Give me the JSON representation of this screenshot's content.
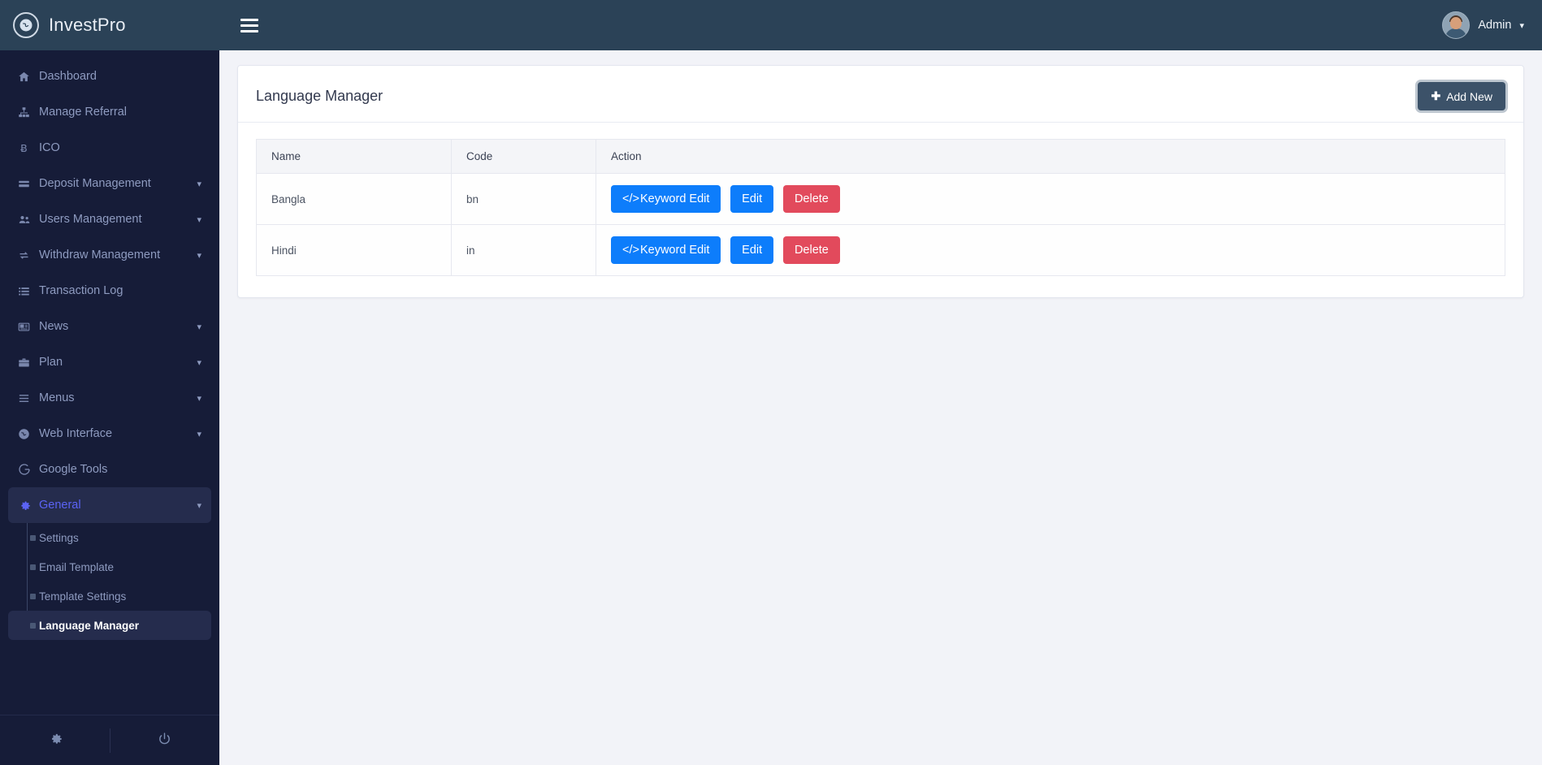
{
  "brand": {
    "name": "InvestPro",
    "logo_icon": "globe-icon"
  },
  "topbar": {
    "menu_icon": "hamburger-icon",
    "admin_label": "Admin",
    "admin_chevron_icon": "chevron-down-icon",
    "avatar_icon": "user-avatar"
  },
  "sidebar": {
    "items": [
      {
        "label": "Dashboard",
        "icon": "home-icon",
        "has_chevron": false,
        "active": false
      },
      {
        "label": "Manage Referral",
        "icon": "sitemap-icon",
        "has_chevron": false,
        "active": false
      },
      {
        "label": "ICO",
        "icon": "bitcoin-icon",
        "has_chevron": false,
        "active": false
      },
      {
        "label": "Deposit Management",
        "icon": "credit-card-icon",
        "has_chevron": true,
        "active": false
      },
      {
        "label": "Users Management",
        "icon": "users-icon",
        "has_chevron": true,
        "active": false
      },
      {
        "label": "Withdraw Management",
        "icon": "exchange-icon",
        "has_chevron": true,
        "active": false
      },
      {
        "label": "Transaction Log",
        "icon": "list-icon",
        "has_chevron": false,
        "active": false
      },
      {
        "label": "News",
        "icon": "newspaper-icon",
        "has_chevron": true,
        "active": false
      },
      {
        "label": "Plan",
        "icon": "briefcase-icon",
        "has_chevron": true,
        "active": false
      },
      {
        "label": "Menus",
        "icon": "bars-icon",
        "has_chevron": true,
        "active": false
      },
      {
        "label": "Web Interface",
        "icon": "globe-icon",
        "has_chevron": true,
        "active": false
      },
      {
        "label": "Google Tools",
        "icon": "google-icon",
        "has_chevron": false,
        "active": false
      },
      {
        "label": "General",
        "icon": "gear-icon",
        "has_chevron": true,
        "active": true
      }
    ],
    "submenu": [
      {
        "label": "Settings",
        "active": false
      },
      {
        "label": "Email Template",
        "active": false
      },
      {
        "label": "Template Settings",
        "active": false
      },
      {
        "label": "Language Manager",
        "active": true
      }
    ],
    "footer": [
      {
        "icon": "gear-icon",
        "name": "settings-button"
      },
      {
        "icon": "power-icon",
        "name": "logout-button"
      }
    ]
  },
  "page": {
    "title": "Language Manager",
    "add_new_label": "Add New",
    "add_new_icon": "plus-icon"
  },
  "table": {
    "columns": [
      "Name",
      "Code",
      "Action"
    ],
    "rows": [
      {
        "name": "Bangla",
        "code": "bn",
        "actions": [
          {
            "label": "Keyword Edit",
            "style": "primary",
            "icon": "code-icon"
          },
          {
            "label": "Edit",
            "style": "primary",
            "icon": ""
          },
          {
            "label": "Delete",
            "style": "danger",
            "icon": ""
          }
        ]
      },
      {
        "name": "Hindi",
        "code": "in",
        "actions": [
          {
            "label": "Keyword Edit",
            "style": "primary",
            "icon": "code-icon"
          },
          {
            "label": "Edit",
            "style": "primary",
            "icon": ""
          },
          {
            "label": "Delete",
            "style": "danger",
            "icon": ""
          }
        ]
      }
    ]
  },
  "colors": {
    "sidebar_bg": "#161c38",
    "topbar_bg": "#2b4257",
    "accent_active": "#5b63f5",
    "primary_button": "#0d7dfb",
    "danger_button": "#e24a5c",
    "add_button": "#3c5269",
    "page_bg": "#f2f3f8"
  }
}
